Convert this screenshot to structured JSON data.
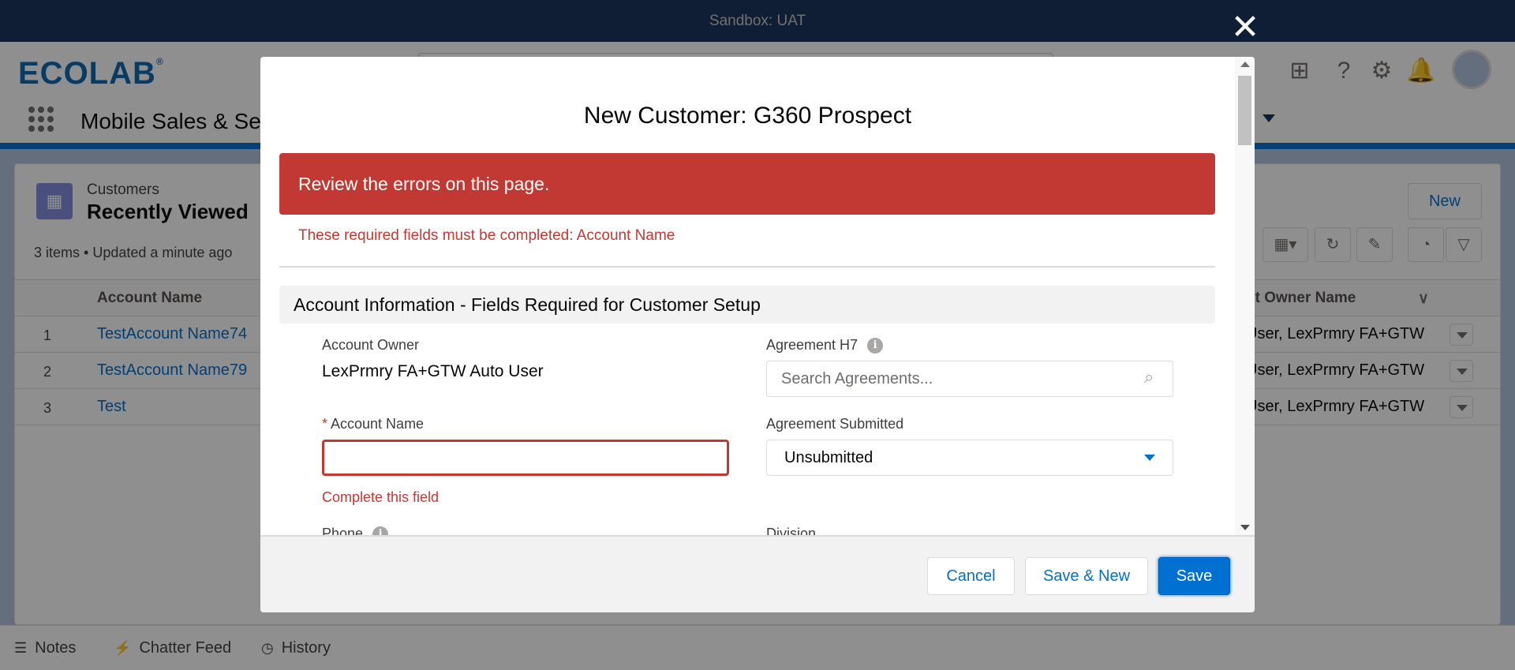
{
  "sandbox": {
    "label": "Sandbox: UAT"
  },
  "brand": {
    "logo_text": "ECOLAB",
    "logo_mark": "®",
    "app_name": "Mobile Sales & Ser"
  },
  "list_view": {
    "object_label": "Customers",
    "title": "Recently Viewed",
    "meta": "3 items • Updated a minute ago",
    "new_label": "New",
    "columns": [
      "Account Name",
      "nt Owner Name"
    ],
    "rows": [
      {
        "num": "1",
        "name": "TestAccount Name74",
        "owner": "User, LexPrmry FA+GTW"
      },
      {
        "num": "2",
        "name": "TestAccount Name79",
        "owner": "User, LexPrmry FA+GTW"
      },
      {
        "num": "3",
        "name": "Test",
        "owner": "User, LexPrmry FA+GTW"
      }
    ]
  },
  "utility_bar": {
    "notes": "Notes",
    "chatter": "Chatter Feed",
    "history": "History"
  },
  "modal": {
    "title": "New Customer: G360 Prospect",
    "error_banner": "Review the errors on this page.",
    "error_detail": "These required fields must be completed: Account Name",
    "section_title": "Account Information - Fields Required for Customer Setup",
    "fields": {
      "account_owner_label": "Account Owner",
      "account_owner_value": "LexPrmry FA+GTW Auto User",
      "agreement_h7_label": "Agreement H7",
      "agreement_h7_placeholder": "Search Agreements...",
      "required_marker": "*",
      "account_name_label": "Account Name",
      "account_name_value": "",
      "account_name_error": "Complete this field",
      "agreement_submitted_label": "Agreement Submitted",
      "agreement_submitted_value": "Unsubmitted",
      "phone_label": "Phone",
      "division_label": "Division"
    },
    "buttons": {
      "cancel": "Cancel",
      "save_new": "Save & New",
      "save": "Save"
    }
  },
  "colors": {
    "error": "#c23934",
    "brand": "#0070d2",
    "header": "#16325c"
  }
}
